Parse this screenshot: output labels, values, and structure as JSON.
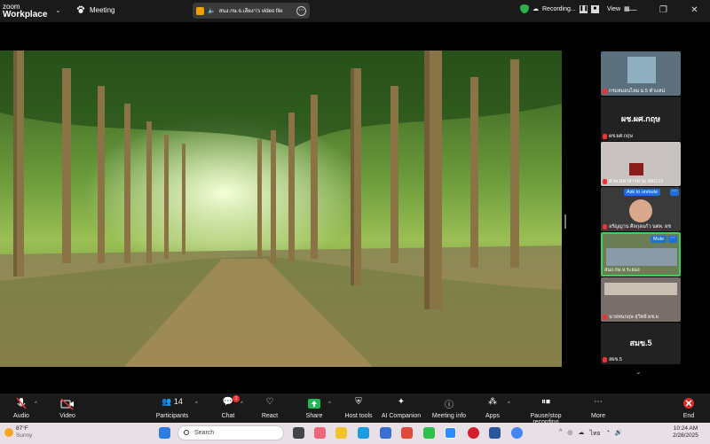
{
  "titlebar": {
    "brand_top": "zoom",
    "brand_bottom": "Workplace",
    "meeting_label": "Meeting",
    "share_label": "สนง.กษ.จ.เลียงา's video file",
    "recording_label": "Recording...",
    "view_label": "View"
  },
  "gallery": {
    "tiles": [
      {
        "name": "กรมหมอนไหม ม.5 ตำแหน่"
      },
      {
        "name": "ผช.ผศ.กฤษ",
        "card": "ผช.ผศ.กฤษ"
      },
      {
        "name": "ศวพ.มหาสารคาม สศป.15"
      },
      {
        "name": "อรัญญาน ศิลกุลแก้ว นตพ. ผช",
        "badge": "Ask to unmute"
      },
      {
        "name": "สนง.กษ.จ.ระยอง",
        "badge": "Mute"
      },
      {
        "name": "นายทนกฤษ สุวิทย์ ผช.ผ"
      },
      {
        "name": "สผข.5",
        "card": "สมข.5"
      }
    ]
  },
  "toolbar": {
    "audio": "Audio",
    "video": "Video",
    "participants": "Participants",
    "participants_count": "14",
    "chat": "Chat",
    "chat_badge": "1",
    "react": "React",
    "share": "Share",
    "host_tools": "Host tools",
    "ai_companion": "AI Companion",
    "meeting_info": "Meeting info",
    "apps": "Apps",
    "pause_stop": "Pause/stop recording",
    "more": "More",
    "end": "End"
  },
  "taskbar": {
    "temp": "87°F",
    "condition": "Sunny",
    "search_placeholder": "Search",
    "lang": "ไทย",
    "time": "10:24 AM",
    "date": "2/28/2025"
  },
  "colors": {
    "end": "#e02828",
    "share": "#1db954",
    "accent": "#1e6fd9"
  }
}
